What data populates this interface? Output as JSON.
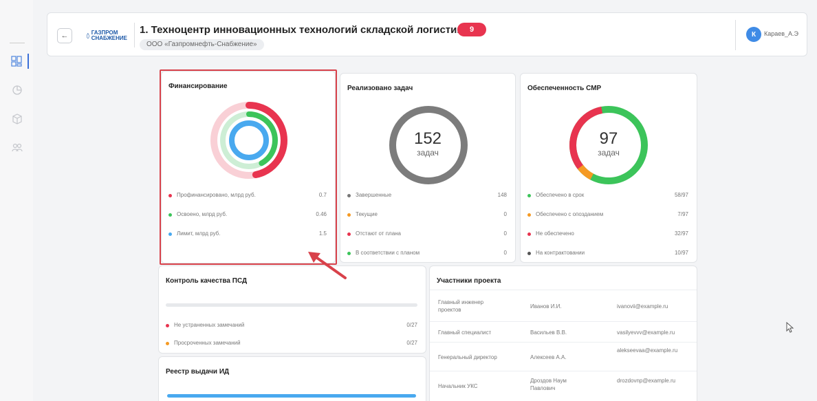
{
  "header": {
    "back_label": "←",
    "logo_line1": "ГАЗПРОМ",
    "logo_line2": "СНАБЖЕНИЕ",
    "title": "1. Техноцентр инновационных технологий складской логистики",
    "badge": "9",
    "org": "ООО «Газпромнефть-Снабжение»",
    "user_initial": "К",
    "user_name": "Караев_А.Э"
  },
  "financing": {
    "title": "Финансирование",
    "legend": [
      {
        "label": "Профинансировано, млрд руб.",
        "value": "0.7",
        "color": "#e8344f"
      },
      {
        "label": "Освоено, млрд руб.",
        "value": "0.46",
        "color": "#3cc45a"
      },
      {
        "label": "Лимит, млрд руб.",
        "value": "1.5",
        "color": "#49a9ef"
      }
    ]
  },
  "tasks": {
    "title": "Реализовано задач",
    "total": "152",
    "unit": "задач",
    "legend": [
      {
        "label": "Завершенные",
        "value": "148",
        "color": "#777777"
      },
      {
        "label": "Текущие",
        "value": "0",
        "color": "#f59a23"
      },
      {
        "label": "Отстают от плана",
        "value": "0",
        "color": "#e8344f"
      },
      {
        "label": "В соответствии с планом",
        "value": "0",
        "color": "#3cc45a"
      }
    ]
  },
  "smr": {
    "title": "Обеспеченность СМР",
    "total": "97",
    "unit": "задач",
    "legend": [
      {
        "label": "Обеспечено в срок",
        "value": "58/97",
        "color": "#3cc45a"
      },
      {
        "label": "Обеспечено с опозданием",
        "value": "7/97",
        "color": "#f59a23"
      },
      {
        "label": "Не обеспечено",
        "value": "32/97",
        "color": "#e8344f"
      },
      {
        "label": "На контрактовании",
        "value": "10/97",
        "color": "#555555"
      }
    ]
  },
  "psd": {
    "title": "Контроль качества ПСД",
    "legend": [
      {
        "label": "Не устраненных замечаний",
        "value": "0/27",
        "color": "#e8344f"
      },
      {
        "label": "Просроченных замечаний",
        "value": "0/27",
        "color": "#f59a23"
      }
    ]
  },
  "id_registry": {
    "title": "Реестр выдачи ИД"
  },
  "participants": {
    "title": "Участники проекта",
    "rows": [
      {
        "role": "Главный инженер проектов",
        "name": "Иванов И.И.",
        "email": "ivanovii@example.ru"
      },
      {
        "role": "Главный специалист",
        "name": "Васильев В.В.",
        "email": "vasilyevvv@example.ru"
      },
      {
        "role": "Генеральный директор",
        "name": "Алексеев А.А.",
        "email": "alekseevaa@example.ru"
      },
      {
        "role": "Начальник УКС",
        "name": "Дроздов Наум Павлович",
        "email": "drozdovnp@example.ru"
      }
    ]
  },
  "colors": {
    "accent_red": "#e8344f",
    "accent_green": "#3cc45a",
    "accent_blue": "#49a9ef",
    "accent_orange": "#f59a23",
    "highlight": "#d8414a"
  }
}
